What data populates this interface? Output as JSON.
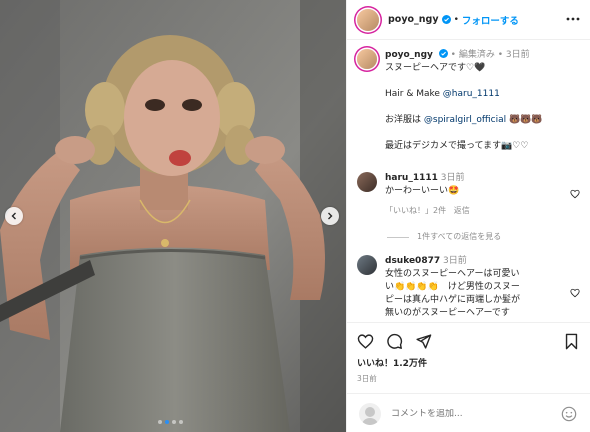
{
  "post": {
    "username": "poyo_ngy",
    "follow_label": "フォローする",
    "separator": "•",
    "edited_label": "編集済み",
    "caption_age": "3日前",
    "caption_lines": [
      "スヌーピーヘアです♡🖤",
      "",
      "Hair & Make @haru_1111",
      "",
      "お洋服は @spiralgirl_official 🐻🐻🐻",
      "",
      "最近はデジカメで撮ってます📷♡♡"
    ],
    "caption_mentions": [
      "@haru_1111",
      "@spiralgirl_official"
    ],
    "likes": "いいね！1.2万件",
    "date": "3日前",
    "add_comment_placeholder": "コメントを追加..."
  },
  "comments": [
    {
      "username": "haru_1111",
      "age": "3日前",
      "text": "かーわーいーい🤩",
      "like_label": "「いいね！」2件",
      "reply_label": "返信"
    },
    {
      "view_replies": "1件すべての返信を見る"
    },
    {
      "username": "dsuke0877",
      "age": "3日前",
      "text_lines": [
        "女性のスヌーピーヘアーは可愛い",
        "い👏👏👏👏　けど男性のスヌー",
        "ピーは真ん中ハゲに両端しか髪が",
        "無いのがスヌーピーヘアーです"
      ]
    }
  ],
  "carousel": {
    "total": 4,
    "active_index": 1
  },
  "colors": {
    "accent": "#0095f6",
    "text": "#262626",
    "muted": "#8e8e8e",
    "link": "#00376b"
  },
  "icons": [
    "chevron-left-icon",
    "chevron-right-icon",
    "verified-badge-icon",
    "more-icon",
    "heart-icon",
    "comment-icon",
    "share-icon",
    "bookmark-icon",
    "emoji-icon"
  ]
}
